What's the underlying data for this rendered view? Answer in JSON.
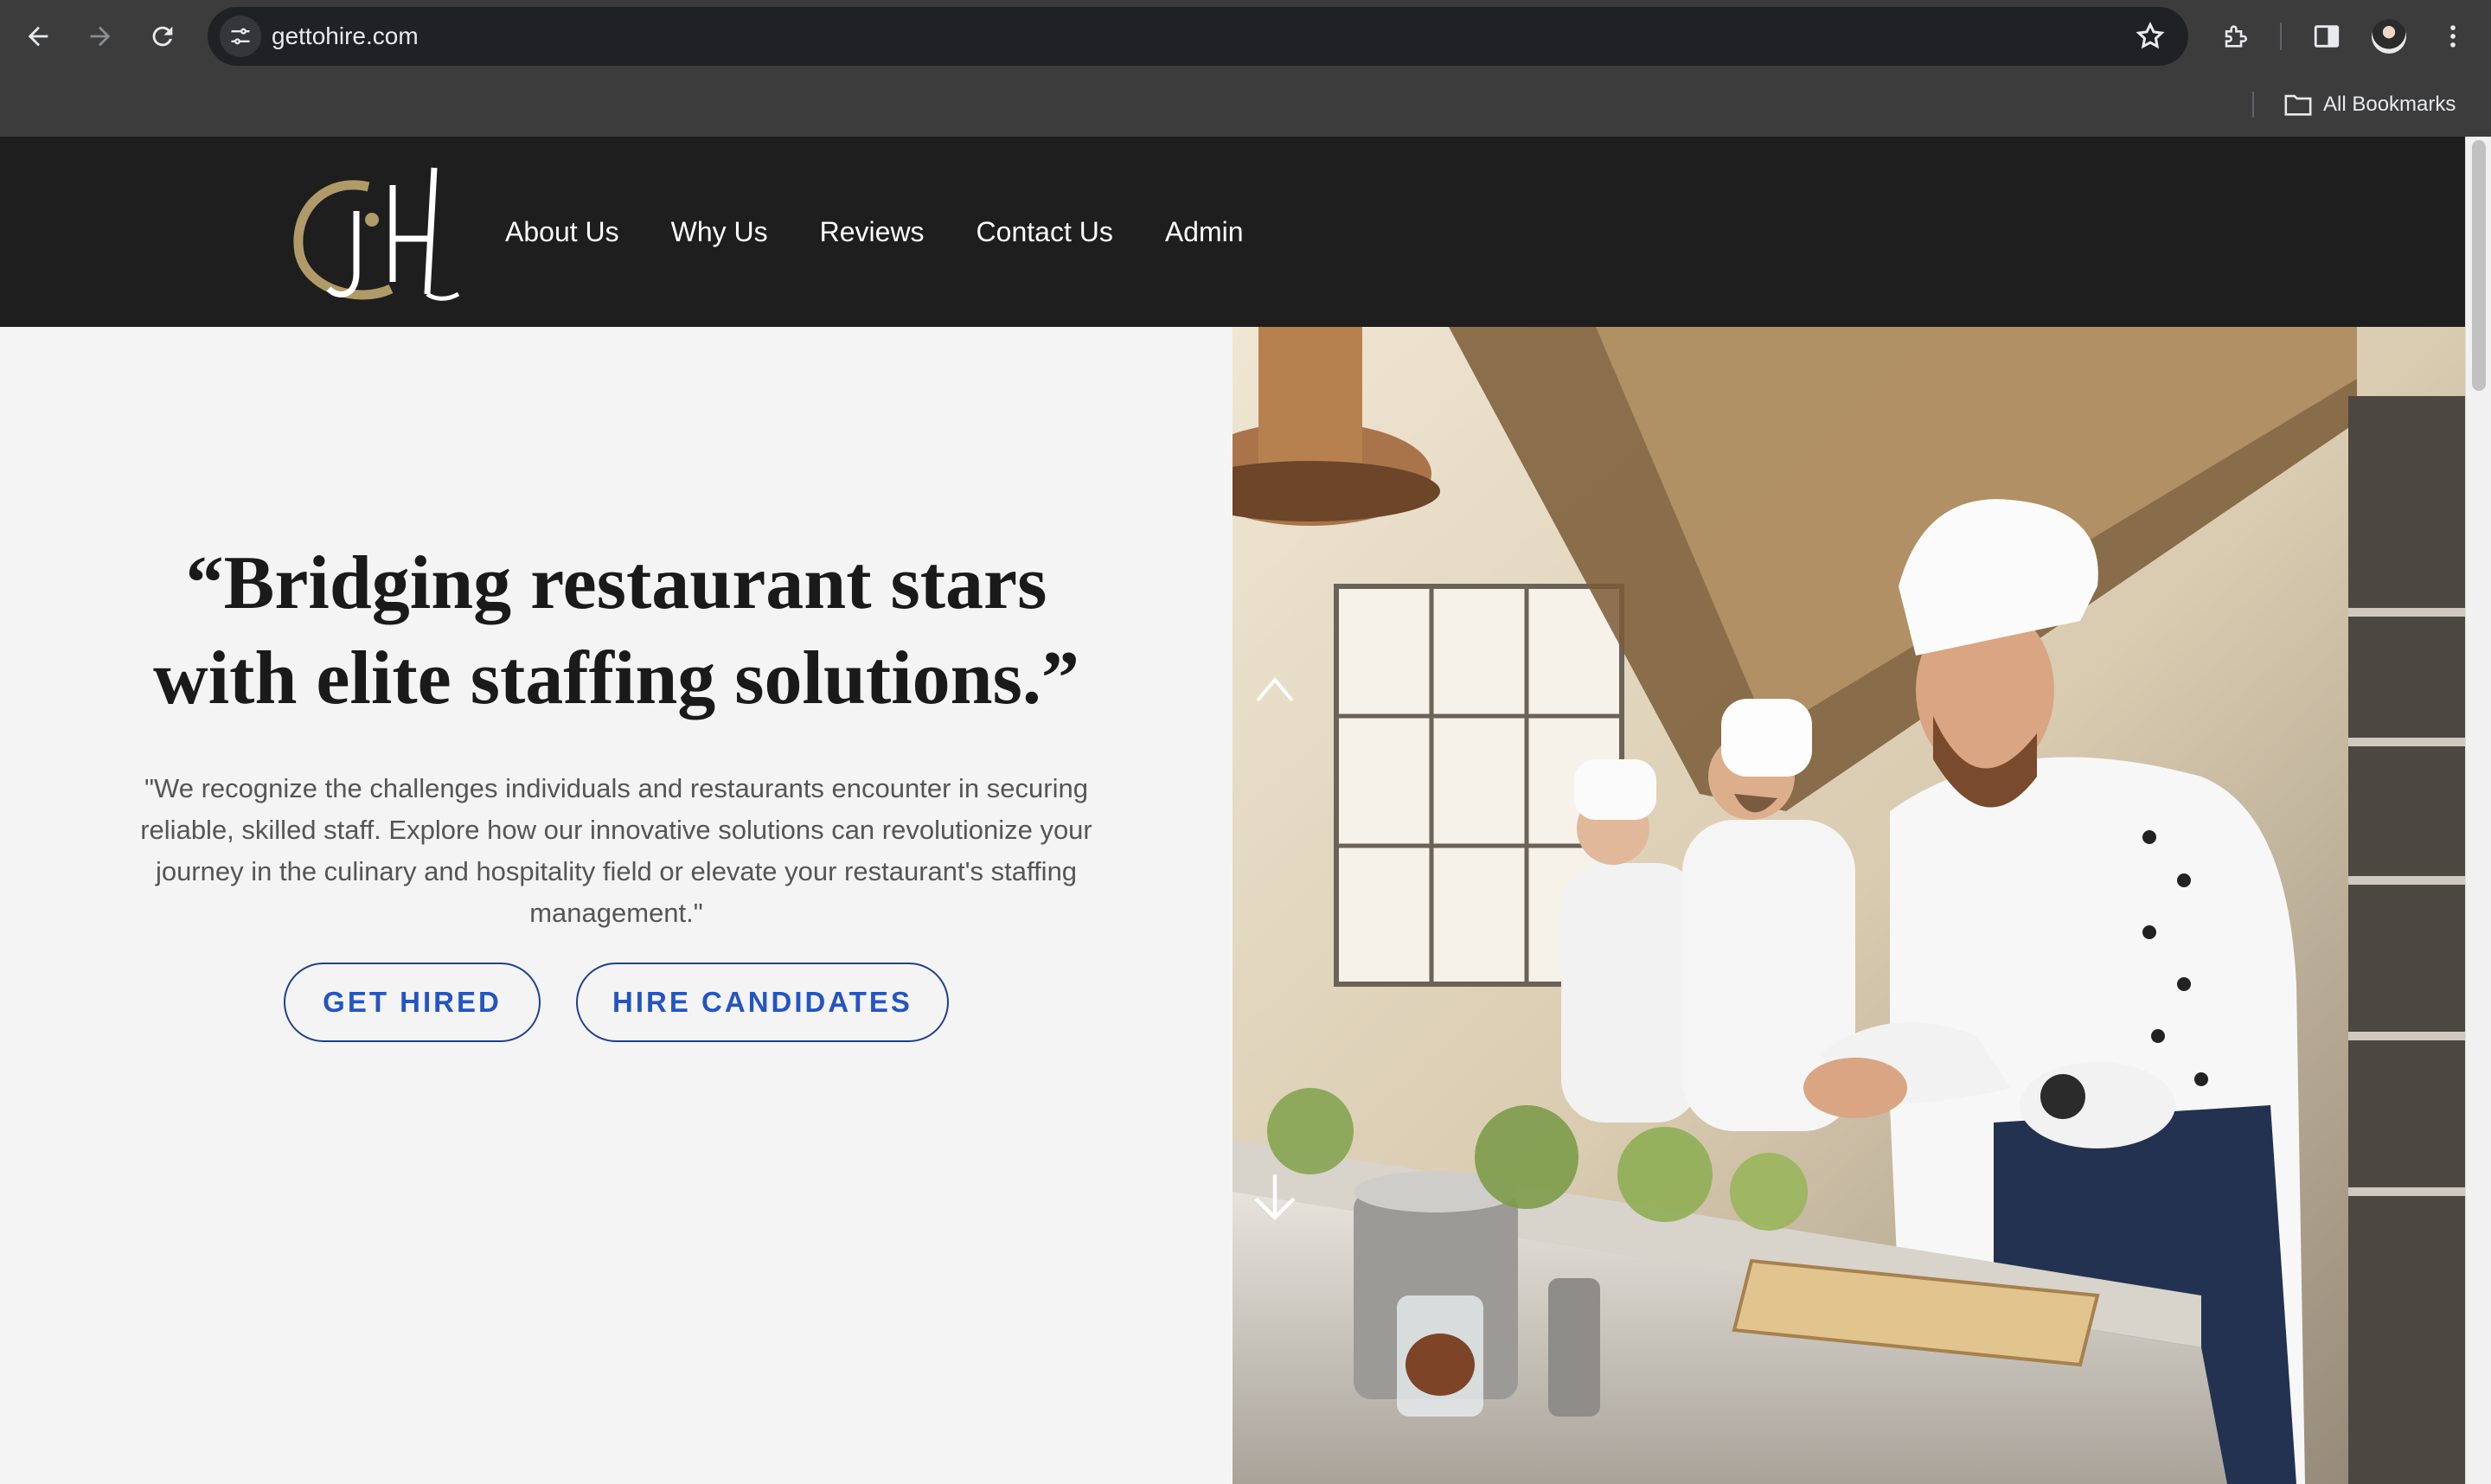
{
  "browser": {
    "url": "gettohire.com",
    "bookmarks_label": "All Bookmarks"
  },
  "site": {
    "logo_alt": "GH",
    "nav": [
      "About Us",
      "Why Us",
      "Reviews",
      "Contact Us",
      "Admin"
    ],
    "hero": {
      "headline_line1": "“Bridging restaurant stars",
      "headline_line2": "with elite staffing solutions.”",
      "subtext": "\"We recognize the challenges individuals and restaurants encounter in securing reliable, skilled staff. Explore how our innovative solutions can revolutionize your journey in the culinary and hospitality field or elevate your restaurant's staffing management.\"",
      "btn_get_hired": "GET HIRED",
      "btn_hire_candidates": "HIRE CANDIDATES"
    }
  },
  "colors": {
    "header_bg": "#1e1e1e",
    "accent_blue": "#2454c4",
    "logo_gold": "#b09a68"
  }
}
